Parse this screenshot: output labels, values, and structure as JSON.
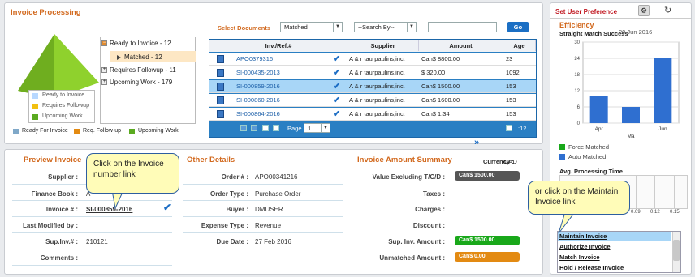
{
  "invoice_processing": {
    "title": "Invoice Processing",
    "tree": {
      "ready": "Ready to Invoice - 12",
      "matched": "Matched - 12",
      "followup": "Requires Followup - 11",
      "upcoming": "Upcoming Work - 179"
    },
    "mini_legend": [
      "Ready to Invoice",
      "Requires Followup",
      "Upcoming Work"
    ],
    "bottom_legend": [
      "Ready For Invoice",
      "Req. Follow-up",
      "Upcoming Work"
    ],
    "select_documents_label": "Select Documents",
    "filter_value": "Matched",
    "search_by": "--Search By--",
    "go_label": "Go",
    "columns": [
      "Inv./Ref.#",
      "Supplier",
      "Amount",
      "Age"
    ],
    "rows": [
      {
        "ref": "APO0379316",
        "supplier": "A & r taurpaulins,inc.",
        "amount": "Can$ 8800.00",
        "age": "23"
      },
      {
        "ref": "SI-000435-2013",
        "supplier": "A & r taurpaulins,inc.",
        "amount": "$ 320.00",
        "age": "1092"
      },
      {
        "ref": "SI-000859-2016",
        "supplier": "A & r taurpaulins,inc.",
        "amount": "Can$ 1500.00",
        "age": "153"
      },
      {
        "ref": "SI-000860-2016",
        "supplier": "A & r taurpaulins,inc.",
        "amount": "Can$ 1600.00",
        "age": "153"
      },
      {
        "ref": "SI-000864-2016",
        "supplier": "A & r taurpaulins,inc.",
        "amount": "Can$ 1.34",
        "age": "153"
      }
    ],
    "page_label": "Page",
    "page_value": "1",
    "total": ":12"
  },
  "preview": {
    "title": "Preview Invoice",
    "supplier_label": "Supplier :",
    "finance_label": "Finance Book :",
    "finance_value": "A",
    "invoice_label": "Invoice # :",
    "invoice_value": "SI-000859-2016",
    "modified_label": "Last Modified by :",
    "supinv_label": "Sup.Inv.# :",
    "supinv_value": "210121",
    "comments_label": "Comments :"
  },
  "other": {
    "title": "Other Details",
    "order_label": "Order # :",
    "order_value": "APO00341216",
    "ordertype_label": "Order Type :",
    "ordertype_value": "Purchase Order",
    "buyer_label": "Buyer :",
    "buyer_value": "DMUSER",
    "expense_label": "Expense Type :",
    "expense_value": "Revenue",
    "due_label": "Due Date :",
    "due_value": "27 Feb 2016"
  },
  "summary": {
    "title": "Invoice Amount Summary",
    "currency_label": "Currency :",
    "currency_value": "CAD",
    "excl_label": "Value Excluding T/C/D :",
    "excl_value": "Can$ 1500.00",
    "taxes_label": "Taxes :",
    "charges_label": "Charges :",
    "discount_label": "Discount :",
    "supamt_label": "Sup. Inv. Amount :",
    "supamt_value": "Can$ 1500.00",
    "unmatched_label": "Unmatched Amount :",
    "unmatched_value": "Can$ 0.00"
  },
  "callouts": {
    "left": "Click on the Invoice number link",
    "right": "or click on the Maintain Invoice link"
  },
  "right_panel": {
    "title": "Set User Preference",
    "efficiency": "Efficiency",
    "straight_match": "Straight Match Success",
    "date": "20 Jun 2016",
    "legend_force": "Force Matched",
    "legend_auto": "Auto Matched",
    "avg_processing": "Avg. Processing Time",
    "menu": [
      "Maintain Invoice",
      "Authorize Invoice",
      "Match Invoice",
      "Hold / Release Invoice"
    ]
  },
  "colors": {
    "accent": "#d2691e",
    "grid": "#2a7fc3",
    "bar": "#2f6fd0",
    "green": "#19a81a",
    "orange": "#e38a12",
    "dark": "#555555"
  },
  "chart_data": [
    {
      "type": "bar",
      "title": "Straight Match Success",
      "categories": [
        "Apr",
        "May",
        "Jun"
      ],
      "tick_labels": [
        "Apr",
        "Ma",
        "Jun"
      ],
      "series": [
        {
          "name": "Auto Matched",
          "values": [
            10,
            6,
            24
          ]
        }
      ],
      "ylim": [
        0,
        30
      ],
      "yticks": [
        "0",
        "6",
        "12",
        "18",
        "24",
        "30"
      ]
    },
    {
      "type": "bar",
      "title": "Avg. Processing Time",
      "xticks": [
        "0.09",
        "0.12",
        "0.15"
      ]
    }
  ]
}
